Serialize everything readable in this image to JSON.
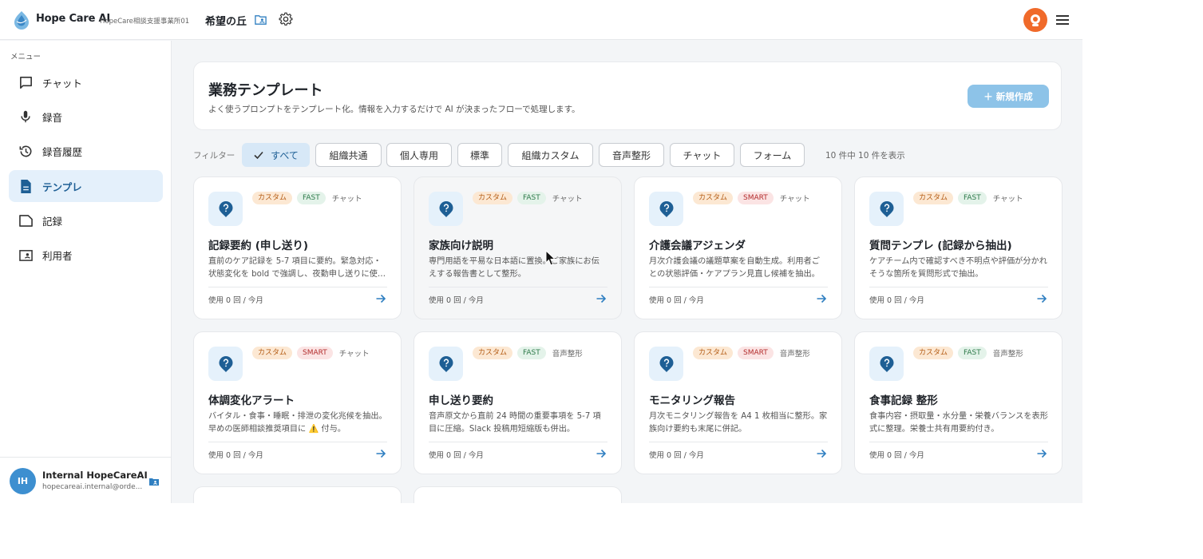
{
  "header": {
    "app_title": "Hope Care AI",
    "office_name": "HopeCare相談支援事業所01",
    "facility_name": "希望の丘"
  },
  "sidebar": {
    "menu_label": "メニュー",
    "items": [
      {
        "label": "チャット",
        "icon": "chat-icon"
      },
      {
        "label": "録音",
        "icon": "mic-icon"
      },
      {
        "label": "録音履歴",
        "icon": "history-icon"
      },
      {
        "label": "テンプレ",
        "icon": "document-icon",
        "active": true
      },
      {
        "label": "記録",
        "icon": "record-icon"
      },
      {
        "label": "利用者",
        "icon": "users-folder-icon"
      }
    ],
    "user": {
      "initials": "IH",
      "name": "Internal HopeCareAI",
      "email": "hopecareai.internal@orde..."
    }
  },
  "main": {
    "title": "業務テンプレート",
    "subtitle": "よく使うプロンプトをテンプレート化。情報を入力するだけで AI が決まったフローで処理します。",
    "new_button": "＋ 新規作成",
    "filter_label": "フィルター",
    "filters": [
      "すべて",
      "組織共通",
      "個人専用",
      "標準",
      "組織カスタム",
      "音声整形",
      "チャット",
      "フォーム"
    ],
    "result_count": "10 件中 10 件を表示"
  },
  "cards": [
    {
      "badge": "カスタム",
      "speed": "FAST",
      "type": "チャット",
      "title": "記録要約 (申し送り)",
      "desc": "直前のケア記録を 5-7 項目に要約。緊急対応・状態変化を bold で強調し、夜勤申し送りに使える形式で出力。",
      "usage": "使用 0 回 / 今月"
    },
    {
      "badge": "カスタム",
      "speed": "FAST",
      "type": "チャット",
      "title": "家族向け説明",
      "desc": "専門用語を平易な日本語に置換。ご家族にお伝えする報告書として整形。",
      "usage": "使用 0 回 / 今月"
    },
    {
      "badge": "カスタム",
      "speed": "SMART",
      "type": "チャット",
      "title": "介護会議アジェンダ",
      "desc": "月次介護会議の議題草案を自動生成。利用者ごとの状態評価・ケアプラン見直し候補を抽出。",
      "usage": "使用 0 回 / 今月"
    },
    {
      "badge": "カスタム",
      "speed": "FAST",
      "type": "チャット",
      "title": "質問テンプレ (記録から抽出)",
      "desc": "ケアチーム内で確認すべき不明点や評価が分かれそうな箇所を質問形式で抽出。",
      "usage": "使用 0 回 / 今月"
    },
    {
      "badge": "カスタム",
      "speed": "SMART",
      "type": "チャット",
      "title": "体調変化アラート",
      "desc": "バイタル・食事・睡眠・排泄の変化兆候を抽出。早めの医師相談推奨項目に ⚠️ 付与。",
      "usage": "使用 0 回 / 今月"
    },
    {
      "badge": "カスタム",
      "speed": "FAST",
      "type": "音声整形",
      "title": "申し送り要約",
      "desc": "音声原文から直前 24 時間の重要事項を 5-7 項目に圧縮。Slack 投稿用短縮版も併出。",
      "usage": "使用 0 回 / 今月"
    },
    {
      "badge": "カスタム",
      "speed": "SMART",
      "type": "音声整形",
      "title": "モニタリング報告",
      "desc": "月次モニタリング報告を A4 1 枚相当に整形。家族向け要約も末尾に併記。",
      "usage": "使用 0 回 / 今月"
    },
    {
      "badge": "カスタム",
      "speed": "FAST",
      "type": "音声整形",
      "title": "食事記録 整形",
      "desc": "食事内容・摂取量・水分量・栄養バランスを表形式に整理。栄養士共有用要約付き。",
      "usage": "使用 0 回 / 今月"
    }
  ],
  "colors": {
    "accent": "#1e5f95",
    "active_nav_bg": "#e4f0fb",
    "new_button": "#8dc3e8",
    "avatar_orange": "#f06a2a",
    "user_avatar": "#3d8fd0"
  }
}
